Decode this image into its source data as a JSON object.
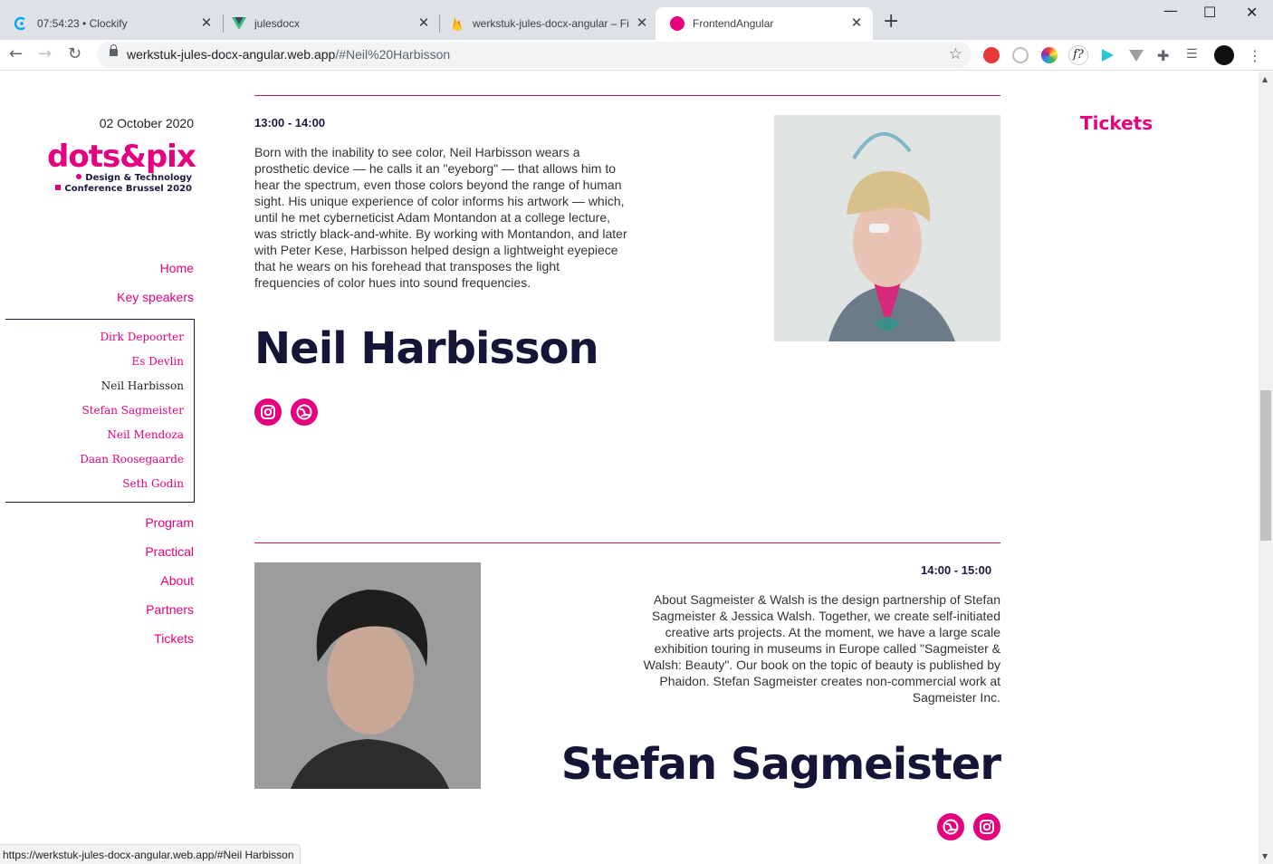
{
  "browser": {
    "tabs": [
      {
        "title": "07:54:23 • Clockify",
        "icon": "clockify-icon"
      },
      {
        "title": "julesdocx",
        "icon": "vue-icon"
      },
      {
        "title": "werkstuk-jules-docx-angular – Fi",
        "icon": "firebase-icon"
      },
      {
        "title": "FrontendAngular",
        "icon": "angular-dot-icon",
        "active": true
      }
    ],
    "url_host": "werkstuk-jules-docx-angular.web.app",
    "url_path": "/#Neil%20Harbisson",
    "status_url": "https://werkstuk-jules-docx-angular.web.app/#Neil Harbisson"
  },
  "sidebar": {
    "date": "02 October 2020",
    "logo": {
      "brand": "dots&pix",
      "tagline_1": "Design & Technology",
      "tagline_2": "Conference Brussel 2020"
    },
    "nav": {
      "home": "Home",
      "key_speakers": "Key speakers",
      "program": "Program",
      "practical": "Practical",
      "about": "About",
      "partners": "Partners",
      "tickets": "Tickets"
    },
    "speakers": [
      "Dirk Depoorter",
      "Es Devlin",
      "Neil Harbisson",
      "Stefan Sagmeister",
      "Neil Mendoza",
      "Daan Roosegaarde",
      "Seth Godin"
    ],
    "current_speaker": "Neil Harbisson"
  },
  "header_tickets": "Tickets",
  "speakers_content": [
    {
      "time": "13:00 - 14:00",
      "name": "Neil Harbisson",
      "bio": "Born with the inability to see color, Neil Harbisson wears a prosthetic device — he calls it an \"eyeborg\" — that allows him to hear the spectrum, even those colors beyond the range of human sight. His unique experience of color informs his artwork — which, until he met cyberneticist Adam Montandon at a college lecture, was strictly black-and-white. By working with Montandon, and later with Peter Kese, Harbisson helped design a lightweight eyepiece that he wears on his forehead that transposes the light frequencies of color hues into sound frequencies.",
      "socials": [
        "instagram-icon",
        "website-icon"
      ]
    },
    {
      "time": "14:00 - 15:00",
      "name": "Stefan Sagmeister",
      "bio": "About Sagmeister & Walsh is the design partnership of Stefan Sagmeister & Jessica Walsh. Together, we create self-initiated creative arts projects. At the moment, we have a large scale exhibition touring in museums in Europe called \"Sagmeister & Walsh: Beauty\". Our book on the topic of beauty is published by Phaidon. Stefan Sagmeister creates non-commercial work at Sagmeister Inc.",
      "socials": [
        "website-icon",
        "instagram-icon"
      ]
    }
  ],
  "colors": {
    "accent": "#e6007e",
    "heading": "#151538"
  }
}
